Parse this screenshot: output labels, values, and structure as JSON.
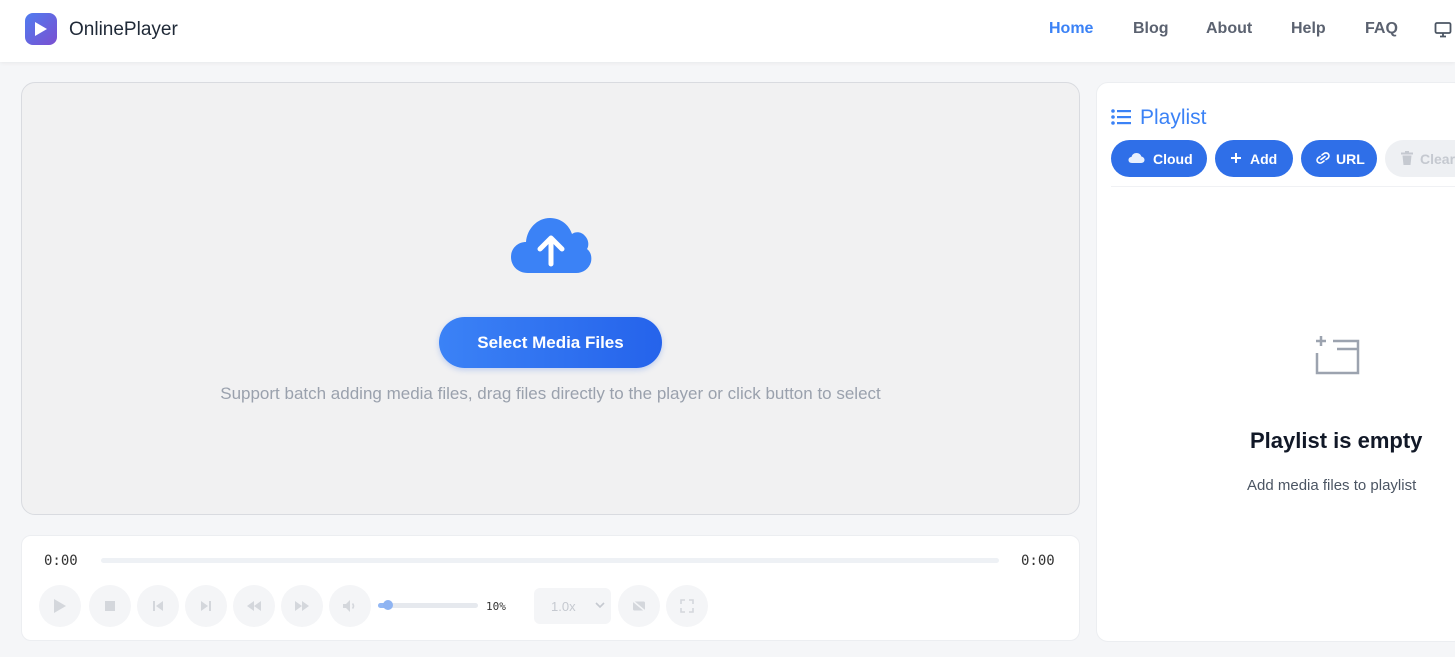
{
  "header": {
    "brand": "OnlinePlayer",
    "nav": [
      {
        "label": "Home",
        "active": true
      },
      {
        "label": "Blog"
      },
      {
        "label": "About"
      },
      {
        "label": "Help"
      },
      {
        "label": "FAQ"
      }
    ],
    "icons": {
      "logo": "play-icon",
      "monitor": "monitor-icon"
    }
  },
  "dropzone": {
    "icon": "cloud-upload-icon",
    "button_label": "Select Media Files",
    "support_text": "Support batch adding media files, drag files directly to the player or click button to select"
  },
  "player": {
    "current_time": "0:00",
    "duration": "0:00",
    "progress": 0,
    "volume_percent": 10,
    "volume_label": "10%",
    "speed": "1.0x",
    "buttons": [
      "play-icon",
      "stop-icon",
      "previous-icon",
      "next-icon",
      "rewind-icon",
      "fast-forward-icon",
      "volume-icon",
      "subtitles-off-icon",
      "fullscreen-icon"
    ]
  },
  "playlist": {
    "title": "Playlist",
    "buttons": {
      "cloud": "Cloud",
      "add": "Add",
      "url": "URL",
      "clear": "Clear"
    },
    "empty_title": "Playlist is empty",
    "empty_sub": "Add media files to playlist"
  },
  "colors": {
    "accent": "#3b82f6",
    "button": "#2f6fe8",
    "muted": "#9aa1ad"
  }
}
